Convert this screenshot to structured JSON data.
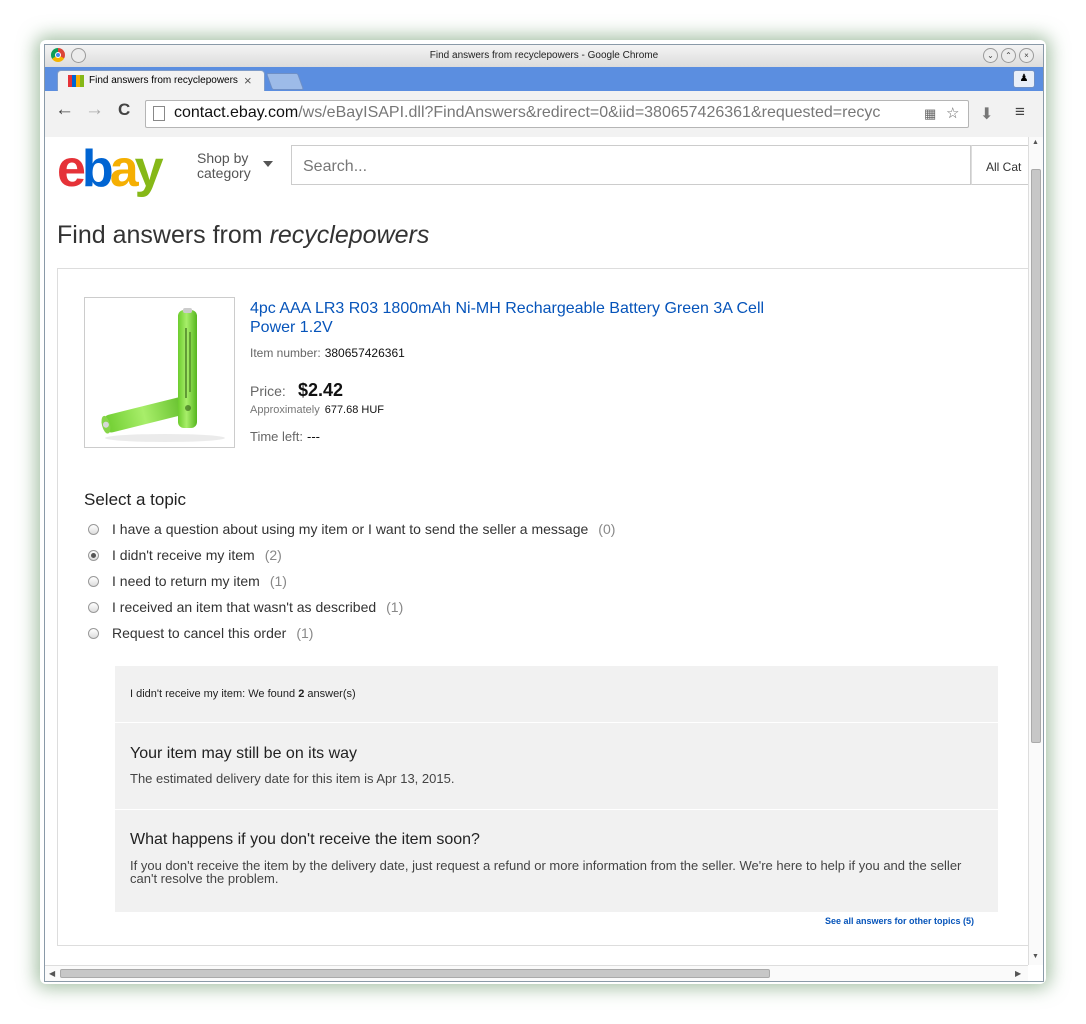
{
  "window": {
    "title": "Find answers from recyclepowers - Google Chrome",
    "buttons": {
      "minimize": "⌄",
      "maximize": "⌃",
      "close": "×"
    }
  },
  "tab": {
    "title": "Find answers from recyclepowers",
    "close": "×"
  },
  "toolbar": {
    "back": "←",
    "forward": "→",
    "reload": "C",
    "url_host": "contact.ebay.com",
    "url_path": "/ws/eBayISAPI.dll?FindAnswers&redirect=0&iid=380657426361&requested=recyc",
    "translate_icon": "▦",
    "star_icon": "☆",
    "download_icon": "⬇",
    "menu_icon": "≡"
  },
  "header": {
    "logo": {
      "e": "e",
      "b": "b",
      "a": "a",
      "y": "y"
    },
    "shop_by_line1": "Shop by",
    "shop_by_line2": "category",
    "search_placeholder": "Search...",
    "all_categories": "All Cat"
  },
  "page": {
    "title_prefix": "Find answers from ",
    "seller": "recyclepowers"
  },
  "item": {
    "title": "4pc AAA LR3 R03 1800mAh Ni-MH Rechargeable Battery Green 3A Cell Power 1.2V",
    "number_label": "Item number:",
    "number": "380657426361",
    "price_label": "Price:",
    "price": "$2.42",
    "approx_label": "Approximately",
    "approx_value": "677.68 HUF",
    "time_left_label": "Time left:",
    "time_left": "---"
  },
  "topics": {
    "heading": "Select a topic",
    "items": [
      {
        "label": "I have a question about using my item or I want to send the seller a message",
        "count": "(0)",
        "selected": false
      },
      {
        "label": "I didn't receive my item",
        "count": "(2)",
        "selected": true
      },
      {
        "label": "I need to return my item",
        "count": "(1)",
        "selected": false
      },
      {
        "label": "I received an item that wasn't as described",
        "count": "(1)",
        "selected": false
      },
      {
        "label": "Request to cancel this order",
        "count": "(1)",
        "selected": false
      }
    ]
  },
  "answers": {
    "header_prefix": "I didn't receive my item: We found ",
    "header_count": "2",
    "header_suffix": " answer(s)",
    "items": [
      {
        "title": "Your item may still be on its way",
        "text": "The estimated delivery date for this item is Apr 13, 2015."
      },
      {
        "title": "What happens if you don't receive the item soon?",
        "text": "If you don't receive the item by the delivery date, just request a refund or more information from the seller. We're here to help if you and the seller can't resolve the problem."
      }
    ],
    "see_all": "See all answers for other topics (5)"
  },
  "colors": {
    "link": "#0654ba",
    "tabstrip": "#5b8ee0"
  }
}
